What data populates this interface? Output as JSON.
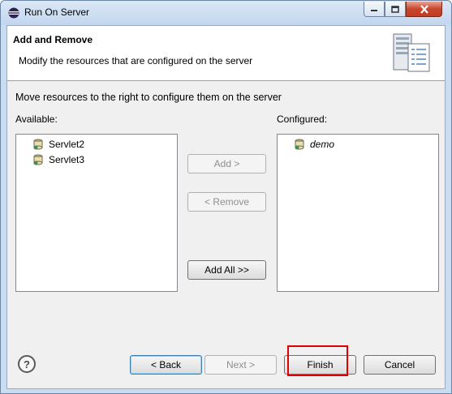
{
  "window": {
    "title": "Run On Server"
  },
  "header": {
    "title": "Add and Remove",
    "description": "Modify the resources that are configured on the server"
  },
  "main": {
    "instructions": "Move resources to the right to configure them on the server",
    "available_label": "Available:",
    "configured_label": "Configured:",
    "available_items": [
      "Servlet2",
      "Servlet3"
    ],
    "configured_items": [
      "demo"
    ]
  },
  "buttons": {
    "add": "Add >",
    "remove": "< Remove",
    "add_all": "Add All >>",
    "back": "< Back",
    "next": "Next >",
    "finish": "Finish",
    "cancel": "Cancel",
    "help": "?"
  },
  "colors": {
    "highlight": "#e00000",
    "title_bar": "#c9dcf0"
  }
}
